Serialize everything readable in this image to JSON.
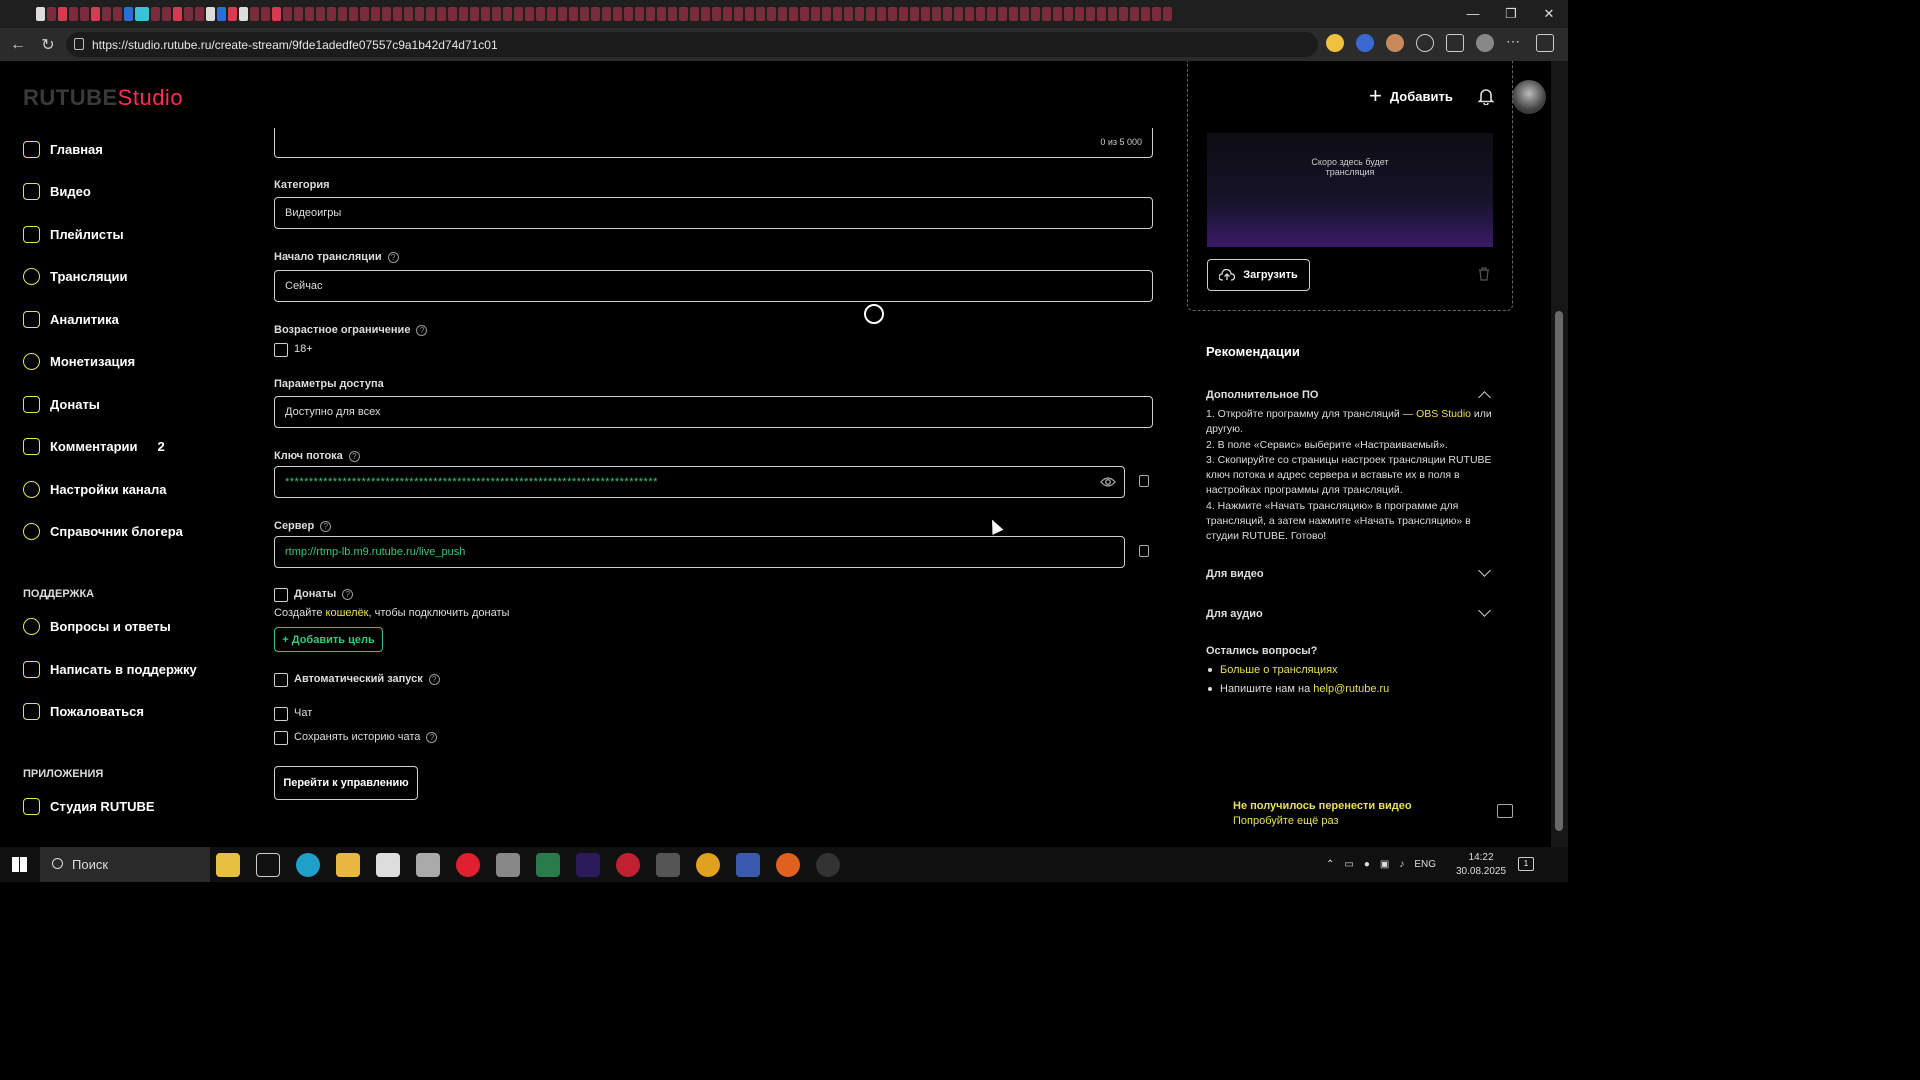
{
  "browser": {
    "url": "https://studio.rutube.ru/create-stream/9fde1adedfe07557c9a1b42d74d71c01"
  },
  "header": {
    "logo_brand": "RUTUBE",
    "logo_studio": "Studio",
    "add_label": "Добавить"
  },
  "sidebar": {
    "items": [
      {
        "label": "Главная",
        "icon": "home-icon"
      },
      {
        "label": "Видео",
        "icon": "video-icon"
      },
      {
        "label": "Плейлисты",
        "icon": "playlist-icon"
      },
      {
        "label": "Трансляции",
        "icon": "broadcast-icon"
      },
      {
        "label": "Аналитика",
        "icon": "analytics-icon"
      },
      {
        "label": "Монетизация",
        "icon": "ruble-icon"
      },
      {
        "label": "Донаты",
        "icon": "donate-icon"
      },
      {
        "label": "Комментарии",
        "icon": "comment-icon",
        "badge": "2"
      },
      {
        "label": "Настройки канала",
        "icon": "gear-icon"
      },
      {
        "label": "Справочник блогера",
        "icon": "info-icon"
      }
    ],
    "support_title": "ПОДДЕРЖКА",
    "support_items": [
      {
        "label": "Вопросы и ответы",
        "icon": "question-icon"
      },
      {
        "label": "Написать в поддержку",
        "icon": "mail-icon"
      },
      {
        "label": "Пожаловаться",
        "icon": "flag-icon"
      }
    ],
    "apps_title": "ПРИЛОЖЕНИЯ",
    "apps_items": [
      {
        "label": "Студия RUTUBE",
        "icon": "studio-icon"
      }
    ]
  },
  "form": {
    "description_counter": "0 из 5 000",
    "category_label": "Категория",
    "category_value": "Видеоигры",
    "start_label": "Начало трансляции",
    "start_value": "Сейчас",
    "age_label": "Возрастное ограничение",
    "age_option": "18+",
    "access_label": "Параметры доступа",
    "access_value": "Доступно для всех",
    "key_label": "Ключ потока",
    "key_value": "******************************************************************************",
    "server_label": "Сервер",
    "server_value": "rtmp://rtmp-lb.m9.rutube.ru/live_push",
    "donations_label": "Донаты",
    "donations_hint_prefix": "Создайте ",
    "donations_hint_link": "кошелёк",
    "donations_hint_suffix": ", чтобы подключить донаты",
    "add_goal_label": "+ Добавить цель",
    "autostart_label": "Автоматический запуск",
    "chat_label": "Чат",
    "save_history_label": "Сохранять историю чата",
    "manage_button": "Перейти к управлению"
  },
  "right": {
    "preview_text": "Скоро здесь будет трансляция",
    "upload_label": "Загрузить",
    "recommendations_title": "Рекомендации",
    "software_title": "Дополнительное ПО",
    "step1_prefix": "1. Откройте программу для трансляций — ",
    "step1_link": "OBS Studio",
    "step1_suffix": " или другую.",
    "step2": "2. В поле «Сервис» выберите «Настраиваемый».",
    "step3": "3. Скопируйте со страницы настроек трансляции RUTUBE ключ потока и адрес сервера и вставьте их в поля в настройках программы для трансляций.",
    "step4": "4. Нажмите «Начать трансляцию» в программе для трансляций, а затем нажмите «Начать трансляцию» в студии RUTUBE. Готово!",
    "for_video": "Для видео",
    "for_audio": "Для аудио",
    "questions_title": "Остались вопросы?",
    "more_link": "Больше о трансляциях",
    "write_prefix": "Напишите нам на ",
    "write_email": "help@rutube.ru"
  },
  "toast": {
    "title": "Не получилось перенести видео",
    "retry": "Попробуйте ещё раз"
  },
  "taskbar": {
    "search_placeholder": "Поиск",
    "lang": "ENG",
    "time": "14:22",
    "date": "30.08.2025",
    "notif_count": "1"
  },
  "colors": {
    "accent": "#e8e055",
    "green": "#39c878",
    "brand_red": "#ff2c55"
  }
}
